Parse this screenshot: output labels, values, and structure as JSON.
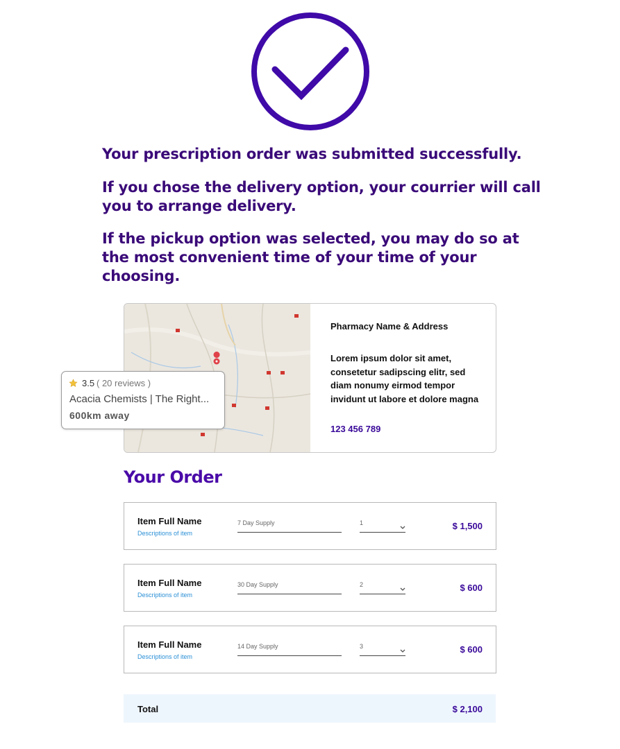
{
  "confirmation": {
    "icon": "check-circle-icon",
    "accent_color": "#3f0aa8",
    "line1": "Your prescription order was submitted successfully.",
    "line2": "If you chose the delivery option, your courrier will call you to arrange delivery.",
    "line3": "If the pickup option was selected, you may do so at the most convenient time of your time of your choosing."
  },
  "pharmacy": {
    "title": "Pharmacy Name & Address",
    "address": "Lorem ipsum dolor sit amet, consetetur sadipscing elitr, sed diam nonumy eirmod tempor invidunt ut labore et dolore magna",
    "phone": "123 456 789"
  },
  "map_popup": {
    "rating": "3.5",
    "reviews": "( 20 reviews )",
    "name": "Acacia Chemists | The Right...",
    "distance": "600km away"
  },
  "order": {
    "title": "Your Order",
    "items": [
      {
        "name": "Item Full Name",
        "description": "Descriptions of item",
        "supply": "7 Day Supply",
        "quantity": "1",
        "price": "$ 1,500"
      },
      {
        "name": "Item Full Name",
        "description": "Descriptions of item",
        "supply": "30 Day Supply",
        "quantity": "2",
        "price": "$ 600"
      },
      {
        "name": "Item Full Name",
        "description": "Descriptions of item",
        "supply": "14 Day Supply",
        "quantity": "3",
        "price": "$ 600"
      }
    ],
    "total_label": "Total",
    "total_value": "$ 2,100"
  }
}
